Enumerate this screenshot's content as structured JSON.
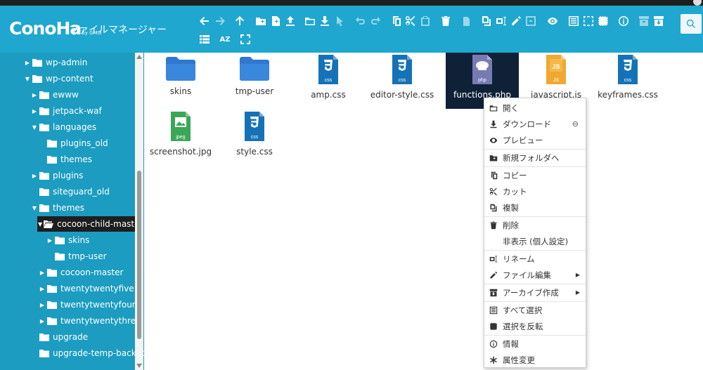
{
  "app": {
    "logo": "ConoHa",
    "logo_sub": "by GMO",
    "title": "ファイルマネージャー"
  },
  "toolbar": {
    "sort_label": "AZ"
  },
  "tree": [
    {
      "label": "wp-admin",
      "caret": "▶"
    },
    {
      "label": "wp-content",
      "caret": "▼"
    },
    {
      "label": "ewww",
      "caret": "▶"
    },
    {
      "label": "jetpack-waf",
      "caret": "▶"
    },
    {
      "label": "languages",
      "caret": "▼"
    },
    {
      "label": "plugins_old",
      "caret": ""
    },
    {
      "label": "themes",
      "caret": ""
    },
    {
      "label": "plugins",
      "caret": "▶"
    },
    {
      "label": "siteguard_old",
      "caret": ""
    },
    {
      "label": "themes",
      "caret": "▼"
    },
    {
      "label": "cocoon-child-master",
      "caret": "▼"
    },
    {
      "label": "skins",
      "caret": "▶"
    },
    {
      "label": "tmp-user",
      "caret": ""
    },
    {
      "label": "cocoon-master",
      "caret": "▶"
    },
    {
      "label": "twentytwentyfive",
      "caret": "▶"
    },
    {
      "label": "twentytwentyfour",
      "caret": "▶"
    },
    {
      "label": "twentytwentythree",
      "caret": "▶"
    },
    {
      "label": "upgrade",
      "caret": ""
    },
    {
      "label": "upgrade-temp-backup",
      "caret": ""
    }
  ],
  "files": [
    {
      "name": "skins",
      "type": "folder"
    },
    {
      "name": "tmp-user",
      "type": "folder"
    },
    {
      "name": "amp.css",
      "type": "css",
      "badge": "css"
    },
    {
      "name": "editor-style.css",
      "type": "css",
      "badge": "css"
    },
    {
      "name": "functions.php",
      "type": "php",
      "badge": "php"
    },
    {
      "name": "javascript.js",
      "type": "js",
      "badge": "JS"
    },
    {
      "name": "keyframes.css",
      "type": "css",
      "badge": "css"
    },
    {
      "name": "screenshot.jpg",
      "type": "jpeg",
      "badge": "jpeg"
    },
    {
      "name": "style.css",
      "type": "css",
      "badge": "css"
    }
  ],
  "context_menu": {
    "open": "開く",
    "download": "ダウンロード",
    "download_link": "⊖",
    "preview": "プレビュー",
    "new_folder": "新規フォルダへ",
    "copy": "コピー",
    "cut": "カット",
    "duplicate": "複製",
    "delete": "削除",
    "hide": "非表示 (個人設定)",
    "rename": "リネーム",
    "edit_file": "ファイル編集",
    "archive": "アーカイブ作成",
    "select_all": "すべて選択",
    "invert_selection": "選択を反転",
    "info": "情報",
    "chmod": "属性変更"
  },
  "colors": {
    "header": "#1fa7cf",
    "sidebar": "#1c9cc0",
    "folder": "#2f78d1",
    "css": "#1572b6",
    "php": "#777bb3",
    "js": "#f0a830",
    "jpeg": "#3aa757",
    "selected_file": "#0f2136"
  }
}
